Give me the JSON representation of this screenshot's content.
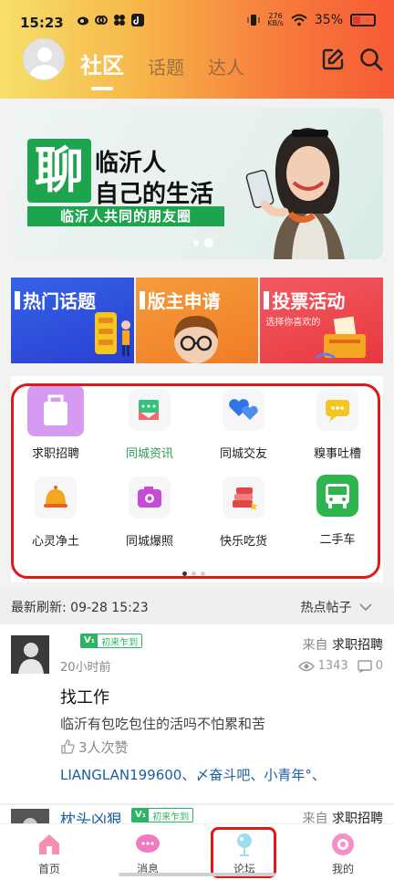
{
  "status_bar": {
    "time": "15:23",
    "net_speed_value": "276",
    "net_speed_unit": "KB/s",
    "battery": "35%"
  },
  "header": {
    "tabs": [
      {
        "label": "社区",
        "active": true
      },
      {
        "label": "话题",
        "active": false
      },
      {
        "label": "达人",
        "active": false
      }
    ],
    "edit_icon": "edit-icon",
    "search_icon": "search-icon"
  },
  "banner": {
    "big_char": "聊",
    "line1": "临沂人",
    "line2": "自己的生活",
    "strip": "临沂人共同的朋友圈"
  },
  "promos": [
    {
      "title": "热门话题",
      "sub": "",
      "color": "#3463e8"
    },
    {
      "title": "版主申请",
      "sub": "",
      "color": "#f59c3c"
    },
    {
      "title": "投票活动",
      "sub": "选择你喜欢的",
      "color": "#f25a62"
    }
  ],
  "grid": [
    {
      "label": "求职招聘",
      "icon": "briefcase-icon",
      "highlight": false
    },
    {
      "label": "同城资讯",
      "icon": "news-icon",
      "highlight": true
    },
    {
      "label": "同城交友",
      "icon": "hearts-icon",
      "highlight": false
    },
    {
      "label": "糗事吐槽",
      "icon": "chat-icon",
      "highlight": false
    },
    {
      "label": "心灵净土",
      "icon": "bell-icon",
      "highlight": false
    },
    {
      "label": "同城爆照",
      "icon": "camera-icon",
      "highlight": false
    },
    {
      "label": "快乐吃货",
      "icon": "cake-icon",
      "highlight": false
    },
    {
      "label": "二手车",
      "icon": "bus-icon",
      "highlight": false
    }
  ],
  "refresh": {
    "label": "最新刷新:  09-28 15:23",
    "sort": "热点帖子"
  },
  "posts": [
    {
      "badge_v": "V₁",
      "badge_text": "初来乍到",
      "from_label": "来自",
      "from_board": "求职招聘",
      "time": "20小时前",
      "views": "1343",
      "comments": "0",
      "title": "找工作",
      "body": "临沂有包吃包住的活吗不怕累和苦",
      "likes": "3人次赞",
      "likers": "LIANGLAN199600、〆奋斗吧、小青年°、"
    },
    {
      "name": "枕头凶狠",
      "badge_v": "V₁",
      "badge_text": "初来乍到",
      "from_label": "来自",
      "from_board": "求职招聘"
    }
  ],
  "nav": [
    {
      "label": "首页",
      "icon": "home-icon"
    },
    {
      "label": "消息",
      "icon": "message-icon"
    },
    {
      "label": "论坛",
      "icon": "forum-icon"
    },
    {
      "label": "我的",
      "icon": "profile-icon"
    }
  ]
}
